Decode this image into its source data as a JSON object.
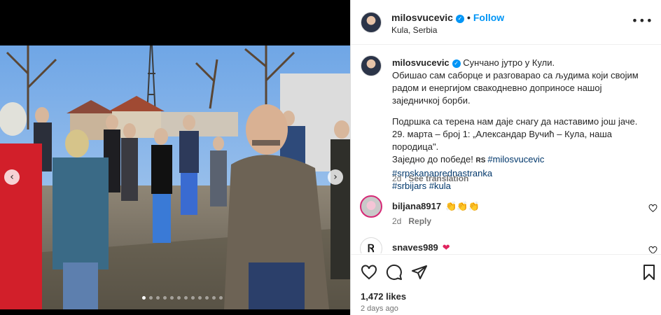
{
  "post": {
    "username": "milosvucevic",
    "follow_label": "Follow",
    "location": "Kula, Serbia",
    "more_label": "•••",
    "caption": {
      "line1": "Сунчано јутро у Кули.",
      "line2": "Обишао сам саборце и разговарао са људима који својим",
      "line3": "радом и енергијом свакодневно доприносе нашој",
      "line4": "заједничкој борби.",
      "line5": "Подршка са терена нам даје снагу да наставимо још јаче.",
      "line6": "29. марта – број 1: „Александар Вучић – Кула, наша",
      "line7": "породица\".",
      "line8_text": "Заједно до победе! ",
      "flag": "RS",
      "hashtags_line8": "#milosvucevic #srpskanaprednastranka",
      "hashtags_line9": "#srbijars #kula",
      "time": "2d",
      "see_translation": "See translation"
    },
    "comments": [
      {
        "username": "biljana8917",
        "text": "👏👏👏",
        "time": "2d",
        "reply": "Reply"
      },
      {
        "username": "snaves989",
        "text": "❤",
        "avatar_letter": "Ꮢ"
      }
    ],
    "likes": "1,472 likes",
    "posted_ago": "2 days ago",
    "carousel": {
      "slide_count": 12,
      "active_index": 0
    },
    "colors": {
      "link": "#0095f6",
      "hashtag": "#00376b",
      "muted": "#737373",
      "text": "#262626"
    }
  }
}
